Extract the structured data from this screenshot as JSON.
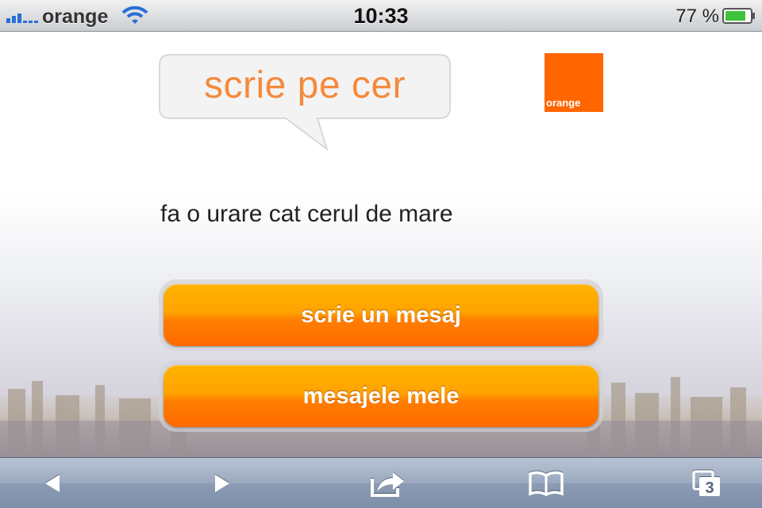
{
  "status_bar": {
    "carrier": "orange",
    "time": "10:33",
    "battery": "77 %",
    "icons": [
      "signal-icon",
      "wifi-icon",
      "battery-icon"
    ]
  },
  "page": {
    "bubble_text": "scrie pe cer",
    "logo_text": "orange",
    "tagline": "fa o urare cat cerul de mare",
    "buttons": {
      "write": "scrie un mesaj",
      "my_messages": "mesajele mele"
    }
  },
  "toolbar": {
    "icons": [
      "back-icon",
      "forward-icon",
      "share-icon",
      "bookmarks-icon",
      "pages-icon"
    ],
    "pages_count": "3"
  },
  "colors": {
    "brand_orange": "#ff6600",
    "button_top": "#ffb300",
    "button_bottom": "#ff6a00",
    "bubble_text": "#f58a3c"
  }
}
